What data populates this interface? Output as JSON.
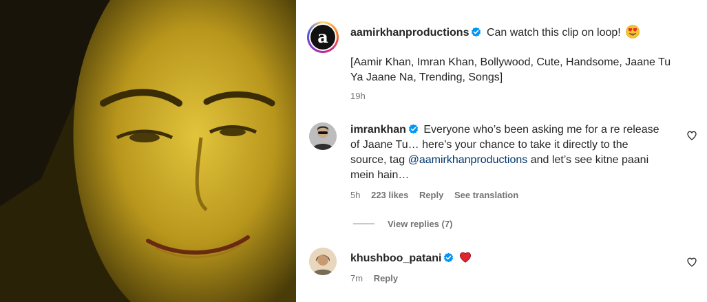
{
  "post": {
    "author": "aamirkhanproductions",
    "caption": "Can watch this clip on loop!",
    "caption_emoji": "heart-eyes-emoji",
    "tags": "[Aamir Khan, Imran Khan, Bollywood, Cute, Handsome, Jaane Tu Ya Jaane Na, Trending, Songs]",
    "time": "19h",
    "avatar_letter": "a"
  },
  "comments": [
    {
      "username": "imrankhan",
      "text_before": "Everyone who’s been asking me for a re release of Jaane Tu… here’s your chance to take it directly to the source, tag",
      "mention": "@aamirkhanproductions",
      "text_after": "and let’s see kitne paani mein hain…",
      "time": "5h",
      "likes": "223 likes",
      "reply": "Reply",
      "translate": "See translation",
      "view_replies": "View replies (7)"
    },
    {
      "username": "khushboo_patani",
      "emoji": "red-heart-emoji",
      "time": "7m",
      "reply": "Reply"
    }
  ],
  "colors": {
    "verified": "#0095f6",
    "mention": "#00376b",
    "secondary_text": "#737373"
  },
  "icons": {
    "like": "heart-outline-icon",
    "verified": "verified-badge-icon"
  }
}
